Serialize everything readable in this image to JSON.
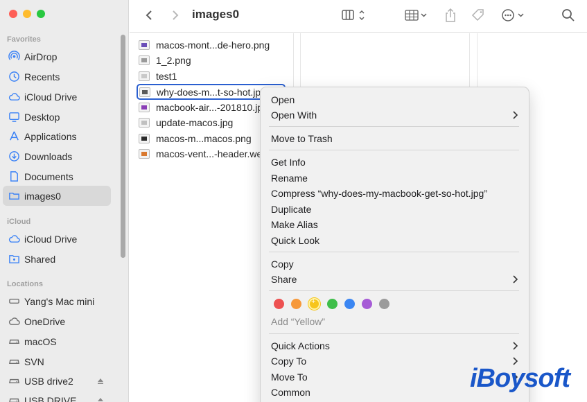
{
  "window": {
    "title": "images0"
  },
  "sidebar": {
    "sections": [
      {
        "title": "Favorites"
      },
      {
        "title": "iCloud"
      },
      {
        "title": "Locations"
      }
    ],
    "favorites": [
      {
        "label": "AirDrop",
        "icon": "airdrop-icon"
      },
      {
        "label": "Recents",
        "icon": "clock-icon"
      },
      {
        "label": "iCloud Drive",
        "icon": "cloud-icon"
      },
      {
        "label": "Desktop",
        "icon": "desktop-icon"
      },
      {
        "label": "Applications",
        "icon": "applications-icon"
      },
      {
        "label": "Downloads",
        "icon": "download-icon"
      },
      {
        "label": "Documents",
        "icon": "document-icon"
      },
      {
        "label": "images0",
        "icon": "folder-icon",
        "selected": true
      }
    ],
    "icloud": [
      {
        "label": "iCloud Drive",
        "icon": "cloud-icon"
      },
      {
        "label": "Shared",
        "icon": "shared-folder-icon"
      }
    ],
    "locations": [
      {
        "label": "Yang's Mac mini",
        "icon": "computer-icon"
      },
      {
        "label": "OneDrive",
        "icon": "cloud-icon"
      },
      {
        "label": "macOS",
        "icon": "disk-icon"
      },
      {
        "label": "SVN",
        "icon": "disk-icon"
      },
      {
        "label": "USB drive2",
        "icon": "disk-icon"
      },
      {
        "label": "USB DRIVE",
        "icon": "disk-icon"
      }
    ]
  },
  "files": [
    {
      "name": "macos-mont...de-hero.png",
      "thumb": "#6b4fb8"
    },
    {
      "name": "1_2.png",
      "thumb": "#9a9a9a"
    },
    {
      "name": "test1",
      "thumb": "#c9c9c9"
    },
    {
      "name": "why-does-m...t-so-hot.jpg",
      "thumb": "#5a5a5a",
      "selected": true
    },
    {
      "name": "macbook-air...-201810.jpg",
      "thumb": "#8a3fb6"
    },
    {
      "name": "update-macos.jpg",
      "thumb": "#c0c0c0"
    },
    {
      "name": "macos-m...macos.png",
      "thumb": "#2b2b2b"
    },
    {
      "name": "macos-vent...-header.webp",
      "thumb": "#d9792f"
    }
  ],
  "context_menu": {
    "items": {
      "open": "Open",
      "open_with": "Open With",
      "move_to_trash": "Move to Trash",
      "get_info": "Get Info",
      "rename": "Rename",
      "compress": "Compress “why-does-my-macbook-get-so-hot.jpg”",
      "duplicate": "Duplicate",
      "make_alias": "Make Alias",
      "quick_look": "Quick Look",
      "copy": "Copy",
      "share": "Share",
      "add_tag": "Add “Yellow”",
      "quick_actions": "Quick Actions",
      "copy_to": "Copy To",
      "move_to": "Move To",
      "common": "Common"
    },
    "tag_colors": [
      "#ed5151",
      "#f6993b",
      "#f7c51c",
      "#3fbe4a",
      "#3b86f2",
      "#a65bd6",
      "#9b9b9b"
    ]
  },
  "watermark": "iBoysoft"
}
